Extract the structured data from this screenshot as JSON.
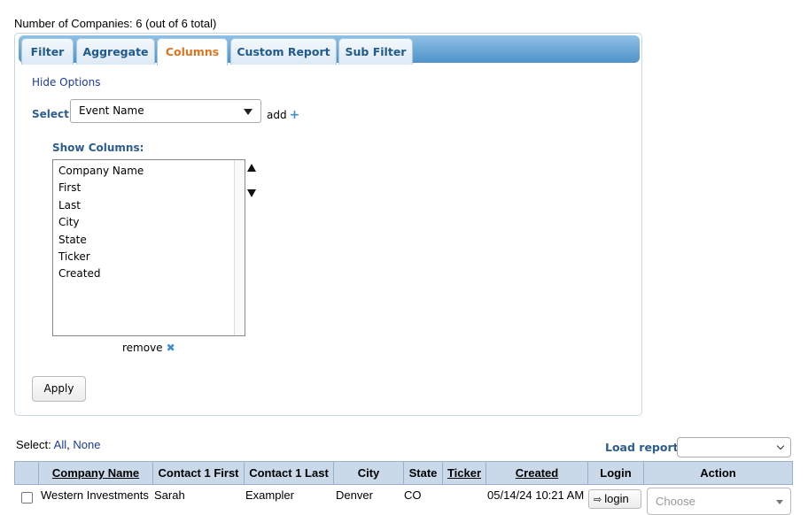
{
  "summary": {
    "count_text": "Number of Companies: 6 (out of 6 total)"
  },
  "tabs": [
    {
      "label": "Filter"
    },
    {
      "label": "Aggregate"
    },
    {
      "label": "Columns",
      "active": true
    },
    {
      "label": "Custom Report"
    },
    {
      "label": "Sub Filter"
    }
  ],
  "options": {
    "hide_label": "Hide Options",
    "select_label": "Select:",
    "select_value": "Event Name",
    "add_label": "add",
    "add_icon": "+",
    "show_columns_label": "Show Columns:",
    "columns": [
      "Company Name",
      "First",
      "Last",
      "City",
      "State",
      "Ticker",
      "Created"
    ],
    "remove_label": "remove",
    "remove_icon": "✖",
    "apply_label": "Apply"
  },
  "selection": {
    "label": "Select:",
    "all": "All",
    "sep": ",",
    "none": "None"
  },
  "load_report": {
    "label": "Load report:",
    "value": ""
  },
  "table": {
    "headers": [
      "Company Name",
      "Contact 1 First",
      "Contact 1 Last",
      "City",
      "State",
      "Ticker",
      "Created",
      "Login",
      "Action"
    ],
    "rows": [
      {
        "company": "Western Investments",
        "first": "Sarah",
        "last": "Exampler",
        "city": "Denver",
        "state": "CO",
        "ticker": "",
        "created": "05/14/24 10:21 AM",
        "login_label": "login",
        "action_placeholder": "Choose"
      }
    ]
  },
  "colors": {
    "accent_orange": "#d9751f",
    "tab_blue": "#4f93c9",
    "header_bg": "#c9d9ea",
    "link_blue": "#1d3a9a"
  }
}
